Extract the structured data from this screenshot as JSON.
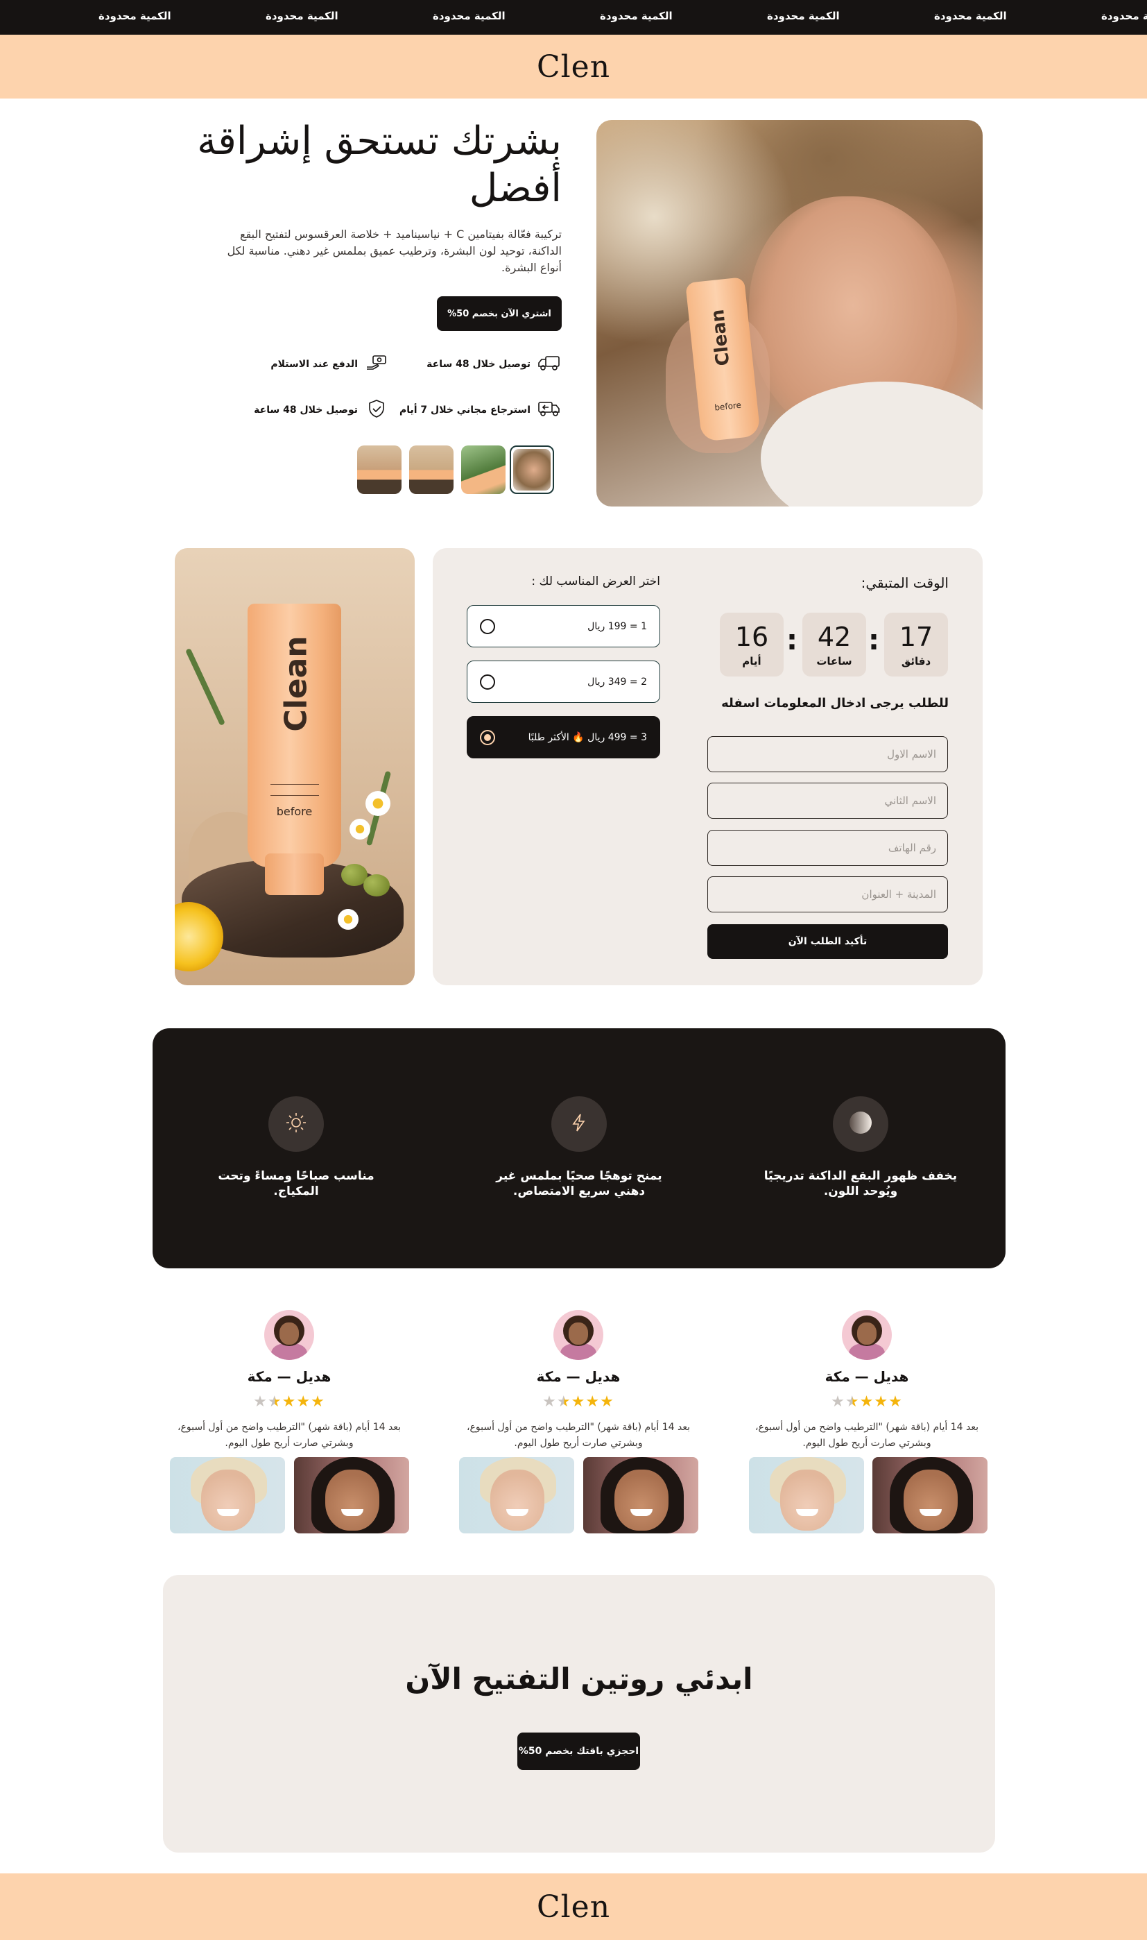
{
  "marquee": {
    "items": [
      "الكمية محدودة",
      "الكمية محدودة",
      "الكمية محدودة",
      "الكمية محدودة",
      "الكمية محدودة",
      "الكمية محدودة",
      "الكمية محدودة"
    ]
  },
  "header": {
    "logo": "Clen"
  },
  "hero": {
    "title": "بشرتك تستحق إشراقة أفضل",
    "description": "تركيبة فعّالة بفيتامين C + نياسيناميد + خلاصة العرقسوس لتفتيح البقع الداكنة، توحيد لون البشرة، وترطيب عميق بملمس غير دهني. مناسبة لكل أنواع البشرة.",
    "cta": "اشتري الآن بخصم 50%",
    "image_tube_text": "Clean",
    "image_tube_sub": "before",
    "features": [
      {
        "label": "توصيل خلال 48 ساعة",
        "icon": "truck-icon"
      },
      {
        "label": "الدفع عند الاستلام",
        "icon": "cash-hand-icon"
      },
      {
        "label": "استرجاع مجاني خلال 7 أيام",
        "icon": "return-truck-icon"
      },
      {
        "label": "توصيل خلال 48 ساعة",
        "icon": "shield-check-icon"
      }
    ]
  },
  "product": {
    "tube_text": "Clean",
    "tube_sub": "before"
  },
  "timer": {
    "label": "الوقت المتبقي:",
    "minutes": {
      "value": "17",
      "unit": "دقائق"
    },
    "hours": {
      "value": "42",
      "unit": "ساعات"
    },
    "days": {
      "value": "16",
      "unit": "أيام"
    }
  },
  "offers": {
    "label": "اختر العرض المناسب لك :",
    "items": [
      {
        "text": "1 = 199 ريال",
        "selected": false
      },
      {
        "text": "2 = 349 ريال",
        "selected": false
      },
      {
        "text": "3 = 499 ريال 🔥 الأكثر طلبًا",
        "selected": true
      }
    ]
  },
  "form": {
    "title": "للطلب يرجى ادخال المعلومات اسفله",
    "first_name": "الاسم الاول",
    "last_name": "الاسم الثاني",
    "phone": "رقم الهاتف",
    "address": "المدينة + العنوان",
    "submit": "تأكيد الطلب الآن"
  },
  "benefits": [
    {
      "text": "يخفف ظهور البقع الداكنة تدريجيًا ويُوحد اللون.",
      "icon": "moon-circle-icon"
    },
    {
      "text": "يمنح توهجًا صحيًا بملمس غير دهني سريع الامتصاص.",
      "icon": "lightning-icon"
    },
    {
      "text": "مناسب صباحًا ومساءً وتحت المكياج.",
      "icon": "sun-icon"
    }
  ],
  "reviews": [
    {
      "name": "هديل — مكة",
      "rating": 4.5,
      "text": "بعد 14 أيام (باقة شهر) \"الترطيب واضح من أول أسبوع، وبشرتي صارت أريح طول اليوم."
    },
    {
      "name": "هديل — مكة",
      "rating": 4.5,
      "text": "بعد 14 أيام (باقة شهر) \"الترطيب واضح من أول أسبوع، وبشرتي صارت أريح طول اليوم."
    },
    {
      "name": "هديل — مكة",
      "rating": 4.5,
      "text": "بعد 14 أيام (باقة شهر) \"الترطيب واضح من أول أسبوع، وبشرتي صارت أريح طول اليوم."
    }
  ],
  "cta": {
    "title": "ابدئي روتين التفتيح الآن",
    "button": "احجزي باقتك بخصم 50%"
  },
  "footer": {
    "logo": "Clen"
  },
  "colors": {
    "accent": "#fdd3ad",
    "dark": "#161312",
    "panel": "#f1ece8",
    "star": "#f4b40c"
  }
}
